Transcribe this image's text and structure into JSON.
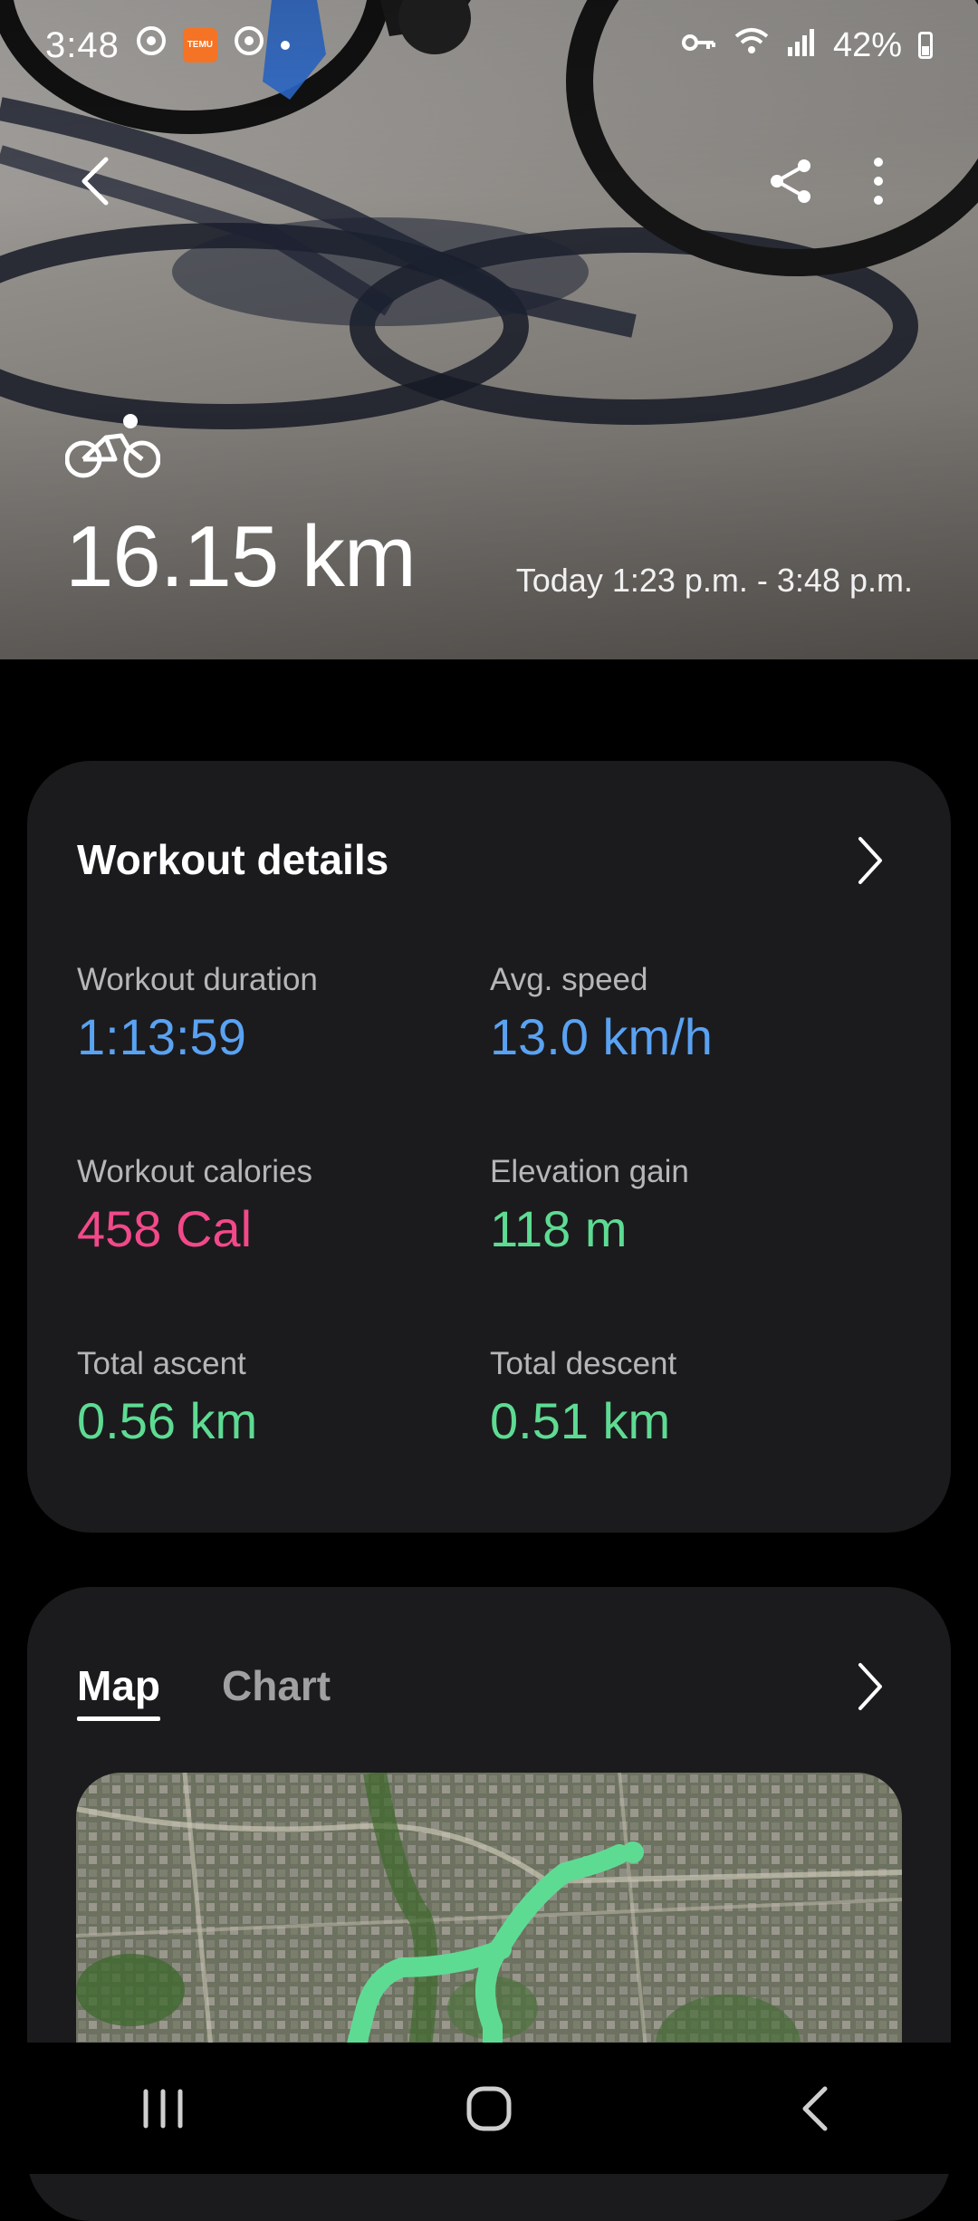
{
  "status_bar": {
    "time": "3:48",
    "battery": "42%",
    "notification_icons": [
      "chrome-icon",
      "temu-icon",
      "chrome-icon",
      "dot-icon"
    ],
    "temu_icon_text": "TEMU",
    "system_icons": [
      "vpn-key-icon",
      "wifi-icon",
      "signal-icon",
      "battery-icon"
    ]
  },
  "header": {
    "back_icon": "back-arrow-icon",
    "share_icon": "share-icon",
    "more_icon": "more-vertical-icon",
    "activity_icon": "cycling-icon",
    "distance": "16.15 km",
    "time_range": "Today 1:23 p.m. - 3:48 p.m."
  },
  "workout_details": {
    "title": "Workout details",
    "stats": [
      {
        "label": "Workout duration",
        "value": "1:13:59",
        "color": "#5aa2f2"
      },
      {
        "label": "Avg. speed",
        "value": "13.0 km/h",
        "color": "#5aa2f2"
      },
      {
        "label": "Workout calories",
        "value": "458 Cal",
        "color": "#f2498a"
      },
      {
        "label": "Elevation gain",
        "value": "118 m",
        "color": "#5edb93"
      },
      {
        "label": "Total ascent",
        "value": "0.56 km",
        "color": "#5edb93"
      },
      {
        "label": "Total descent",
        "value": "0.51 km",
        "color": "#5edb93"
      }
    ]
  },
  "route_section": {
    "tabs": [
      {
        "label": "Map",
        "active": true
      },
      {
        "label": "Chart",
        "active": false
      }
    ],
    "route_color": "#5edb93"
  },
  "nav_bar": {
    "buttons": [
      "recent-apps-icon",
      "home-icon",
      "back-icon"
    ]
  }
}
